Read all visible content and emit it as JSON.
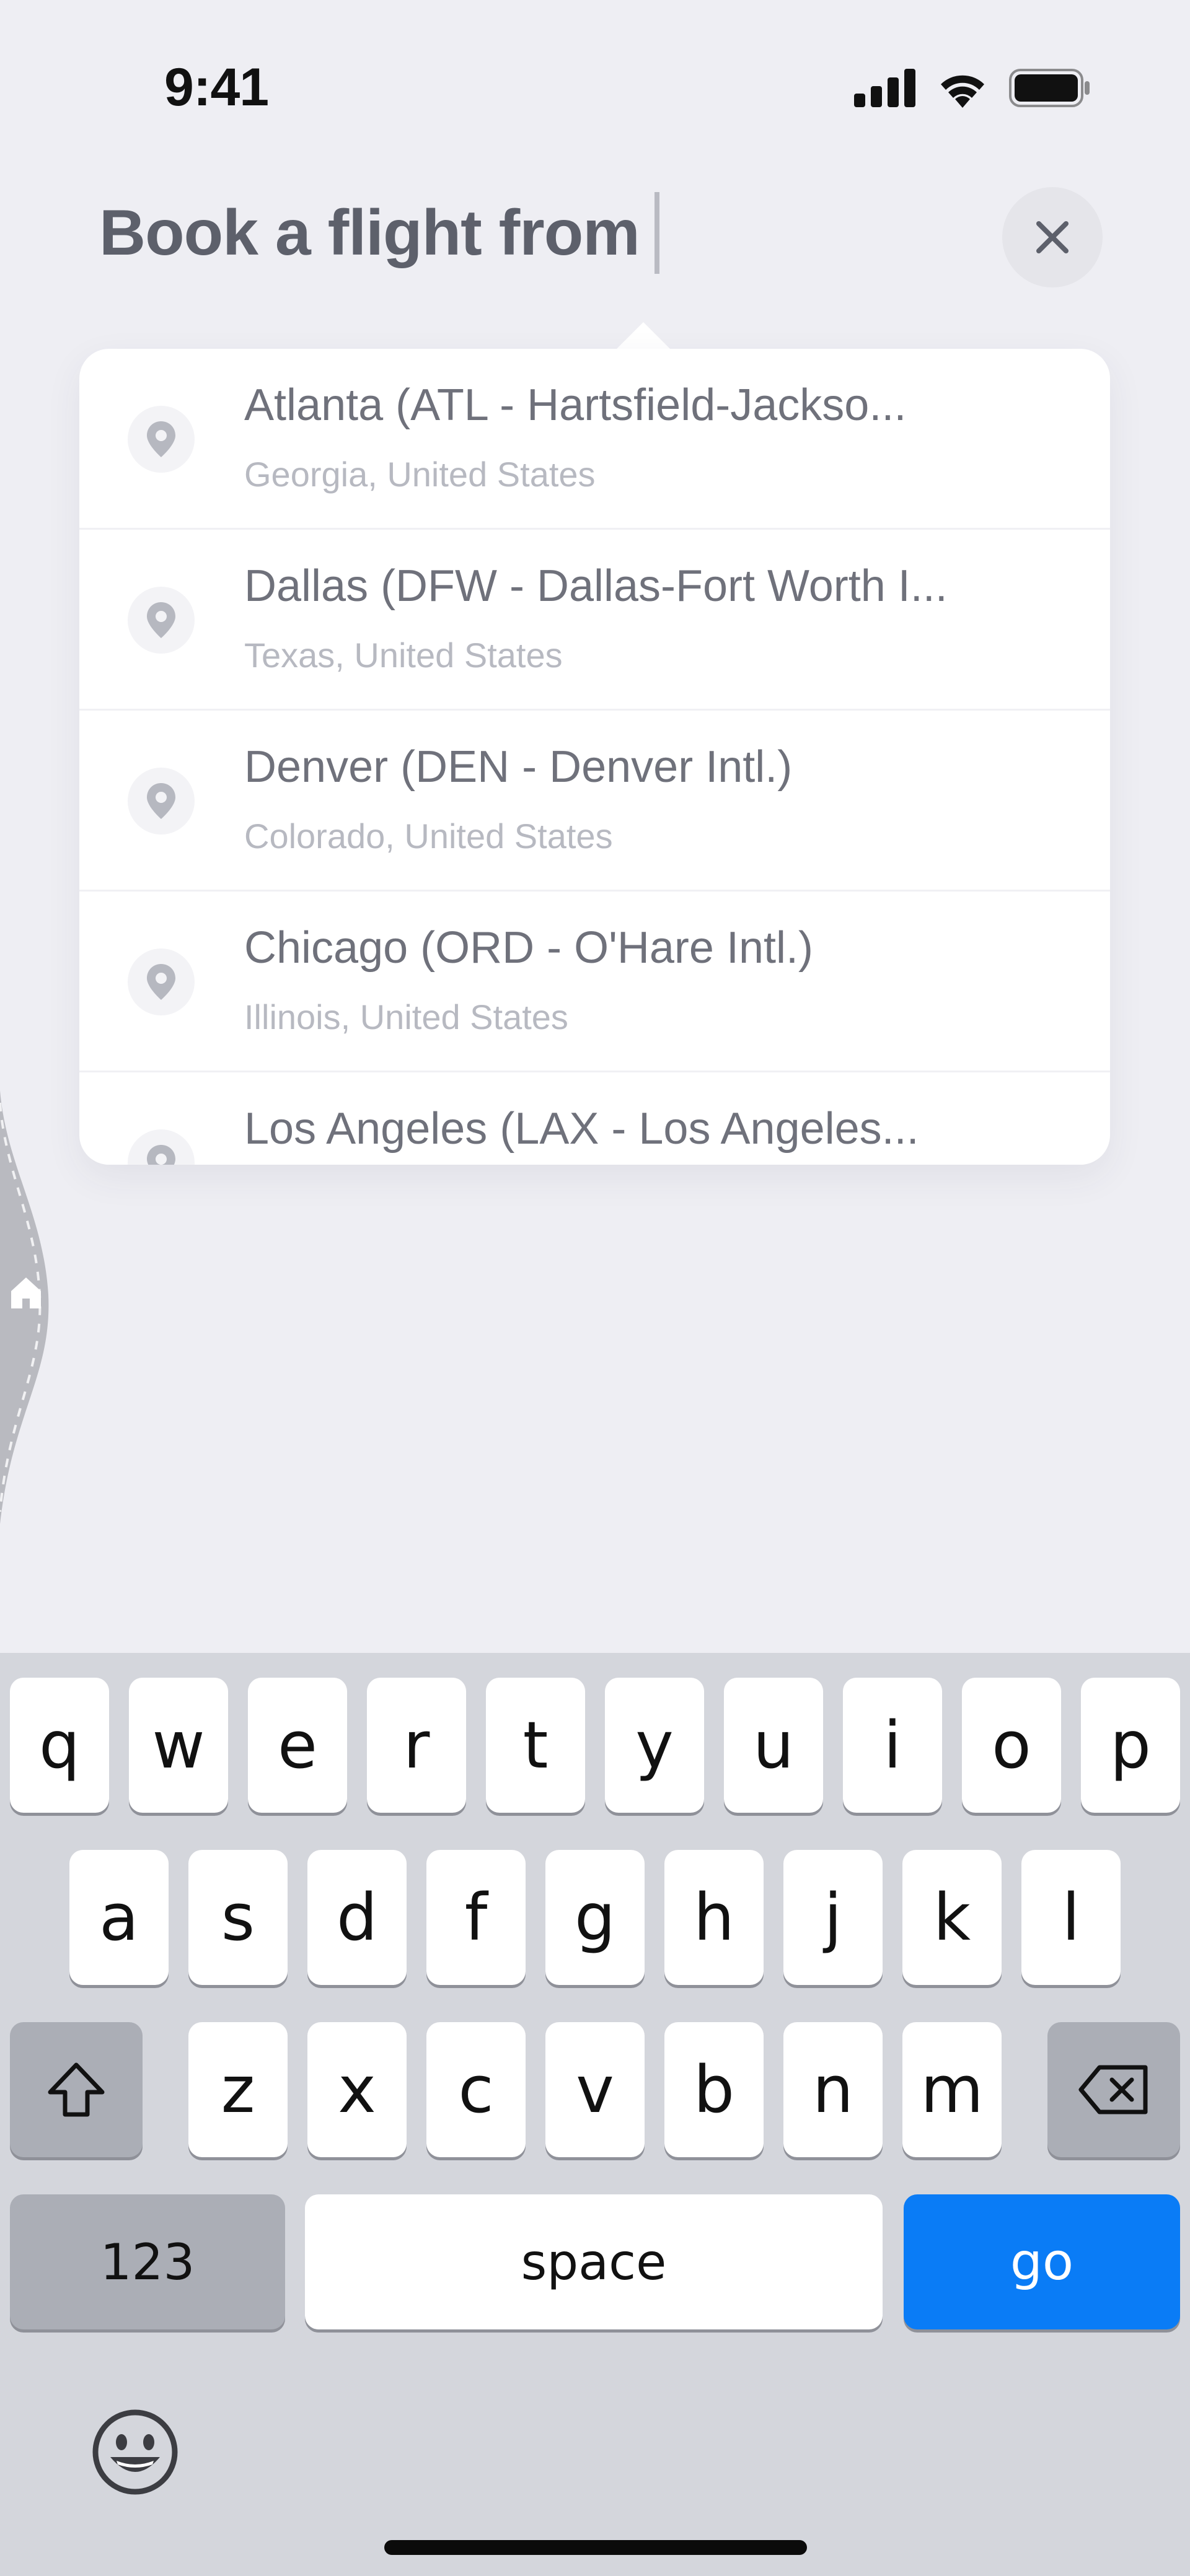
{
  "status": {
    "time": "9:41",
    "icons": [
      "cellular-signal-icon",
      "wifi-icon",
      "battery-icon"
    ]
  },
  "search": {
    "prompt": "Book a flight from",
    "close_icon": "close-icon"
  },
  "results": [
    {
      "title": "Atlanta (ATL - Hartsfield-Jackso...",
      "subtitle": "Georgia, United States",
      "icon": "location-pin-icon"
    },
    {
      "title": "Dallas (DFW - Dallas-Fort Worth I...",
      "subtitle": "Texas, United States",
      "icon": "location-pin-icon"
    },
    {
      "title": "Denver (DEN - Denver Intl.)",
      "subtitle": "Colorado, United States",
      "icon": "location-pin-icon"
    },
    {
      "title": "Chicago (ORD - O'Hare Intl.)",
      "subtitle": "Illinois, United States",
      "icon": "location-pin-icon"
    },
    {
      "title": "Los Angeles (LAX - Los Angeles...",
      "subtitle": "",
      "icon": "location-pin-icon"
    }
  ],
  "keyboard": {
    "row1": [
      "q",
      "w",
      "e",
      "r",
      "t",
      "y",
      "u",
      "i",
      "o",
      "p"
    ],
    "row2": [
      "a",
      "s",
      "d",
      "f",
      "g",
      "h",
      "j",
      "k",
      "l"
    ],
    "row3": [
      "z",
      "x",
      "c",
      "v",
      "b",
      "n",
      "m"
    ],
    "numbers_label": "123",
    "space_label": "space",
    "go_label": "go",
    "shift_icon": "shift-icon",
    "delete_icon": "delete-icon",
    "emoji_icon": "emoji-icon"
  },
  "colors": {
    "background": "#eeeef3",
    "accent": "#0a7cf6",
    "keyboard_bg": "#d4d6dc"
  }
}
